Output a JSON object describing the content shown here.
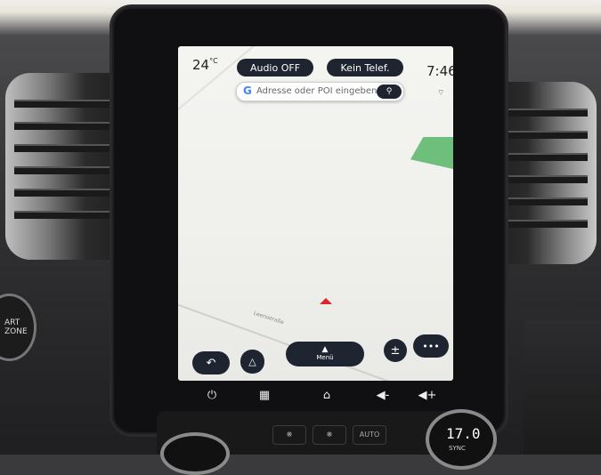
{
  "status_bar": {
    "temperature": "24",
    "temperature_unit": "°C",
    "audio_button": "Audio OFF",
    "phone_button": "Kein Telef.",
    "clock": "7:46"
  },
  "search": {
    "logo": "G",
    "placeholder": "Adresse oder POI eingeben"
  },
  "map": {
    "street_label": "Leersstraße"
  },
  "map_controls": {
    "menu_label": "Menü",
    "zoom_symbol": "±",
    "more_symbol": "•••"
  },
  "bottom_bar": {
    "icons": [
      "power-icon",
      "apps-grid-icon",
      "home-icon",
      "volume-down-icon",
      "volume-up-icon"
    ]
  },
  "climate": {
    "auto_label": "AUTO",
    "temperature_display": "17.0",
    "sync_label": "SYNC",
    "left_label": "ART\nZONE"
  },
  "colors": {
    "button_bg": "#1f2431",
    "position_arrow": "#e0242a",
    "park_green": "#6ebf7b"
  }
}
